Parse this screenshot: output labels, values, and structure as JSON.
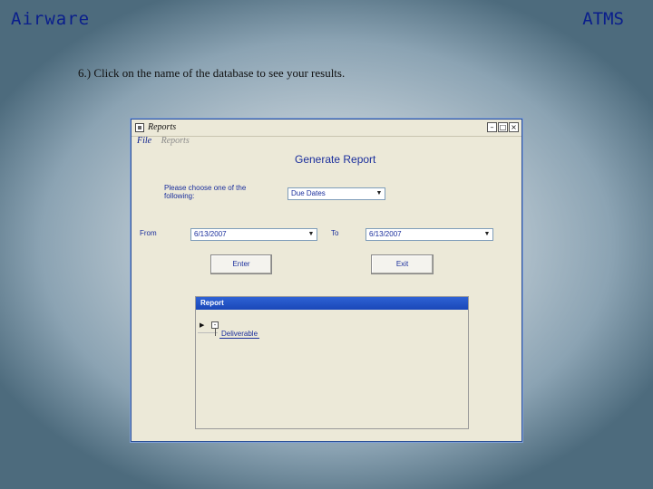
{
  "slide": {
    "title_left": "Airware",
    "title_right": "ATMS",
    "instruction": "6.) Click on the name of the database to see your results."
  },
  "window": {
    "title": "Reports",
    "buttons": {
      "minimize": "–",
      "maximize": "□",
      "close": "×"
    },
    "menu": [
      "File",
      "Reports"
    ]
  },
  "form": {
    "heading": "Generate Report",
    "prompt": "Please choose one of the following:",
    "category_value": "Due Dates",
    "from_label": "From",
    "from_value": "6/13/2007",
    "to_label": "To",
    "to_value": "6/13/2007",
    "enter_label": "Enter",
    "exit_label": "Exit"
  },
  "report": {
    "header": "Report",
    "row_indicator": "▶",
    "expander": "⊟",
    "item": "Deliverable"
  }
}
